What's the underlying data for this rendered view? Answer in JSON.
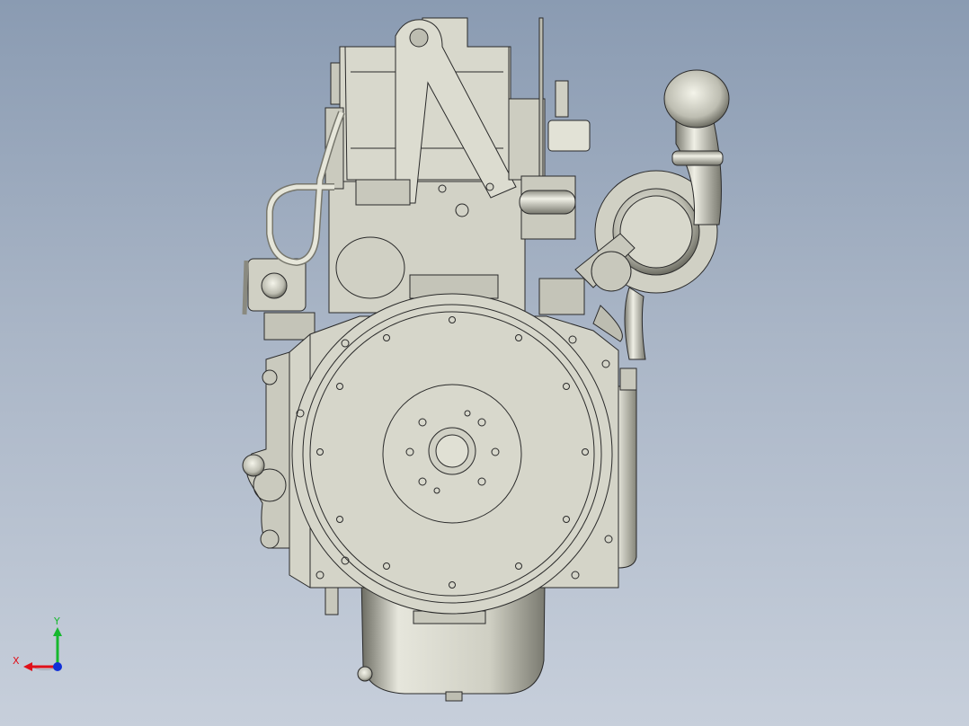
{
  "viewport": {
    "model_name": "engine-rear-view"
  },
  "triad": {
    "x_label": "X",
    "y_label": "Y",
    "x_color": "#e0101a",
    "y_color": "#16b82e",
    "z_color": "#1030d8"
  },
  "colors": {
    "background_top": "#8a9bb2",
    "background_bottom": "#c7cfdb",
    "part_fill": "#d4d4c8",
    "part_shade": "#b9b9ad",
    "edge": "#2a2a2a"
  }
}
